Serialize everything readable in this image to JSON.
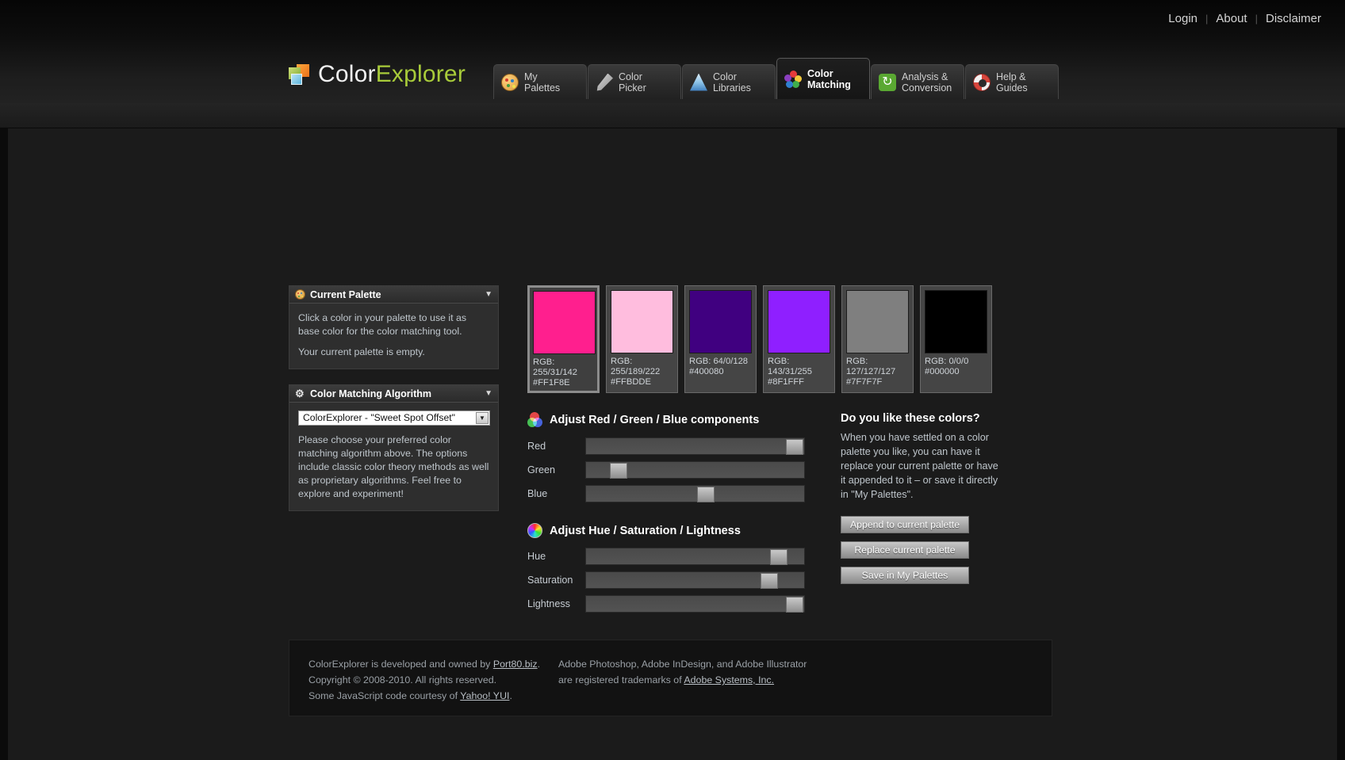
{
  "utilnav": {
    "items": [
      {
        "label": "Login"
      },
      {
        "label": "About"
      },
      {
        "label": "Disclaimer"
      }
    ],
    "separator": "|"
  },
  "brand": {
    "name_part1": "Color",
    "name_part2": "Explorer"
  },
  "tabs": [
    {
      "id": "my-palettes",
      "line1": "My",
      "line2": "Palettes",
      "icon": "palette-icon",
      "active": false
    },
    {
      "id": "color-picker",
      "line1": "Color",
      "line2": "Picker",
      "icon": "eyedropper-icon",
      "active": false
    },
    {
      "id": "color-libraries",
      "line1": "Color",
      "line2": "Libraries",
      "icon": "libraries-icon",
      "active": false
    },
    {
      "id": "color-matching",
      "line1": "Color",
      "line2": "Matching",
      "icon": "color-matching-icon",
      "active": true
    },
    {
      "id": "analysis-conversion",
      "line1": "Analysis &",
      "line2": "Conversion",
      "icon": "convert-icon",
      "active": false
    },
    {
      "id": "help-guides",
      "line1": "Help &",
      "line2": "Guides",
      "icon": "lifebuoy-icon",
      "active": false
    }
  ],
  "current_palette_panel": {
    "title": "Current Palette",
    "icon": "palette-icon",
    "caret": "▼",
    "paragraph1": "Click a color in your palette to use it as base color for the color matching tool.",
    "paragraph2": "Your current palette is empty."
  },
  "algorithm_panel": {
    "title": "Color Matching Algorithm",
    "icon": "gear-icon",
    "caret": "▼",
    "selected_option": "ColorExplorer - \"Sweet Spot Offset\"",
    "select_arrow": "▼",
    "description": "Please choose your preferred color matching algorithm above. The options include classic color theory methods as well as proprietary algorithms. Feel free to explore and experiment!"
  },
  "swatches": [
    {
      "hex": "#FF1F8E",
      "rgb_label": "RGB: 255/31/142",
      "hex_label": "#FF1F8E",
      "selected": true
    },
    {
      "hex": "#FFBDDE",
      "rgb_label": "RGB: 255/189/222",
      "hex_label": "#FFBDDE",
      "selected": false
    },
    {
      "hex": "#400080",
      "rgb_label": "RGB: 64/0/128",
      "hex_label": "#400080",
      "selected": false
    },
    {
      "hex": "#8F1FFF",
      "rgb_label": "RGB: 143/31/255",
      "hex_label": "#8F1FFF",
      "selected": false
    },
    {
      "hex": "#7F7F7F",
      "rgb_label": "RGB: 127/127/127",
      "hex_label": "#7F7F7F",
      "selected": false
    },
    {
      "hex": "#000000",
      "rgb_label": "RGB: 0/0/0",
      "hex_label": "#000000",
      "selected": false
    }
  ],
  "rgb_section": {
    "title": "Adjust Red / Green / Blue components",
    "icon": "rgb-circles-icon",
    "sliders": [
      {
        "name": "red",
        "label": "Red",
        "thumb_percent": 93
      },
      {
        "name": "green",
        "label": "Green",
        "thumb_percent": 12
      },
      {
        "name": "blue",
        "label": "Blue",
        "thumb_percent": 52
      }
    ]
  },
  "hsl_section": {
    "title": "Adjust Hue / Saturation / Lightness",
    "icon": "color-wheel-icon",
    "sliders": [
      {
        "name": "hue",
        "label": "Hue",
        "thumb_percent": 86
      },
      {
        "name": "saturation",
        "label": "Saturation",
        "thumb_percent": 82
      },
      {
        "name": "lightness",
        "label": "Lightness",
        "thumb_percent": 93
      }
    ]
  },
  "like_colors": {
    "title": "Do you like these colors?",
    "text": "When you have settled on a color palette you like, you can have it replace your current palette or have it appended to it – or save it directly in \"My Palettes\".",
    "buttons": [
      {
        "id": "append",
        "label": "Append to current palette"
      },
      {
        "id": "replace",
        "label": "Replace current palette"
      },
      {
        "id": "save",
        "label": "Save in My Palettes"
      }
    ]
  },
  "footer": {
    "left": {
      "line1_pre": "ColorExplorer is developed and owned by ",
      "line1_link": "Port80.biz",
      "line1_post": ".",
      "line2": "Copyright © 2008-2010. All rights reserved.",
      "line3_pre": "Some JavaScript code courtesy of ",
      "line3_link": "Yahoo! YUI",
      "line3_post": "."
    },
    "right": {
      "line1": "Adobe Photoshop, Adobe InDesign, and Adobe Illustrator",
      "line2_pre": "are registered trademarks of ",
      "line2_link": "Adobe Systems, Inc.",
      "line2_post": ""
    }
  }
}
